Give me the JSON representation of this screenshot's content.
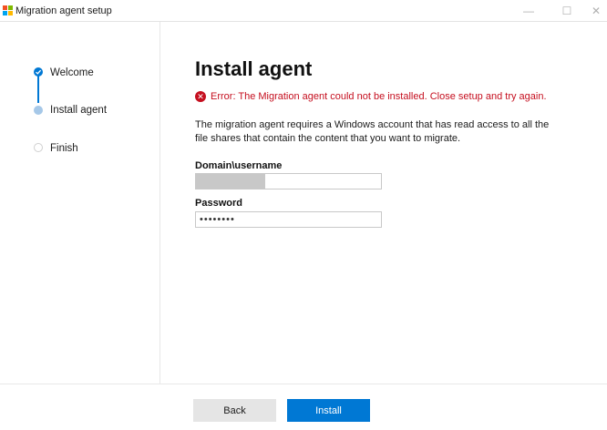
{
  "window": {
    "title": "Migration agent setup",
    "logo_colors": [
      "#f25022",
      "#7fba00",
      "#00a4ef",
      "#ffb900"
    ],
    "controls": {
      "minimize": "—",
      "maximize": "☐",
      "close": "✕"
    }
  },
  "sidebar": {
    "steps": [
      {
        "label": "Welcome",
        "state": "completed"
      },
      {
        "label": "Install agent",
        "state": "current"
      },
      {
        "label": "Finish",
        "state": "pending"
      }
    ]
  },
  "main": {
    "title": "Install agent",
    "error": {
      "icon": "error-x-icon",
      "glyph": "✕",
      "text": "Error: The Migration agent could not be installed. Close setup and try again.",
      "color": "#c50f1f"
    },
    "description": "The migration agent requires a Windows account that has read access to all the file shares that contain the content that you want to migrate.",
    "fields": {
      "domain": {
        "label": "Domain\\username",
        "value": ""
      },
      "password": {
        "label": "Password",
        "value": "••••••••"
      }
    }
  },
  "footer": {
    "back_label": "Back",
    "install_label": "Install"
  },
  "colors": {
    "accent": "#0078d4",
    "accent_light": "#a6c8e8",
    "error": "#c50f1f"
  }
}
